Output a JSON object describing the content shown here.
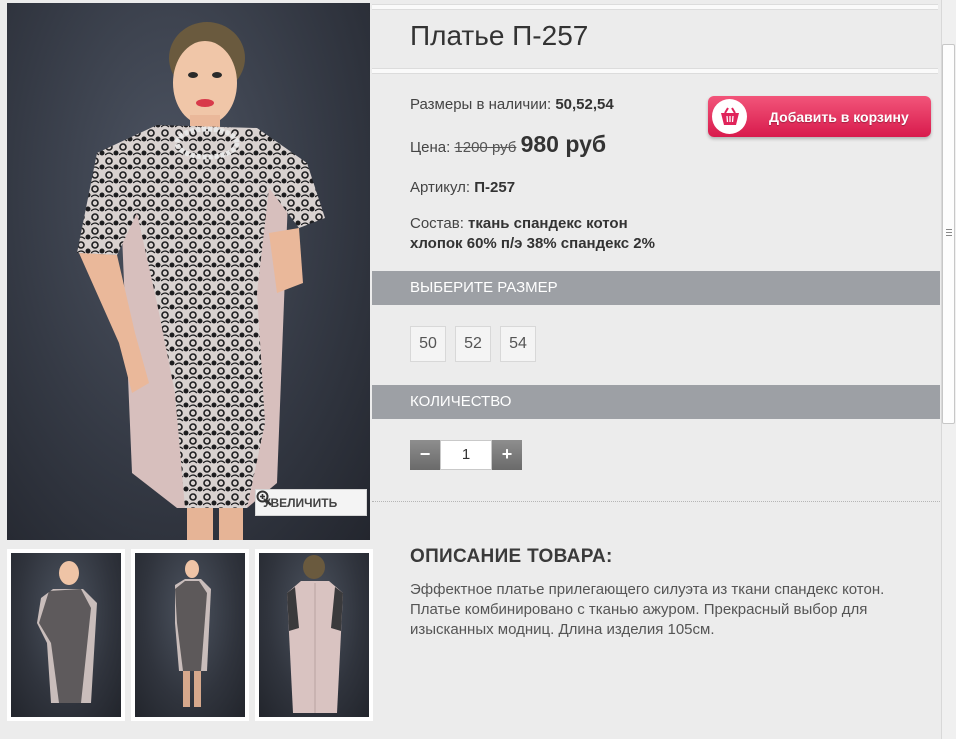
{
  "product": {
    "title": "Платье П-257",
    "sizes_label": "Размеры в наличии:",
    "sizes_value": "50,52,54",
    "price_label": "Цена:",
    "old_price": "1200 руб",
    "new_price": "980 руб",
    "article_label": "Артикул:",
    "article_value": "П-257",
    "composition_label": "Состав:",
    "composition_line1": "ткань спандекс котон",
    "composition_line2": "хлопок 60% п/э 38% спандекс 2%"
  },
  "cart_button": {
    "label": "Добавить в корзину",
    "icon": "basket-icon",
    "color": "#e0245a"
  },
  "zoom_button": {
    "label": "УВЕЛИЧИТЬ",
    "icon": "zoom-in-icon"
  },
  "size_section": {
    "title": "ВЫБЕРИТЕ РАЗМЕР",
    "options": [
      "50",
      "52",
      "54"
    ]
  },
  "quantity_section": {
    "title": "КОЛИЧЕСТВО",
    "value": "1",
    "minus": "−",
    "plus": "+"
  },
  "description": {
    "title": "ОПИСАНИЕ ТОВАРА:",
    "text": "Эффектное платье прилегающего силуэта из ткани спандекс котон. Платье комбинировано с тканью ажуром. Прекрасный выбор для изысканных модниц. Длина изделия 105см."
  },
  "colors": {
    "bar": "#9da0a5",
    "accent": "#e0245a"
  }
}
